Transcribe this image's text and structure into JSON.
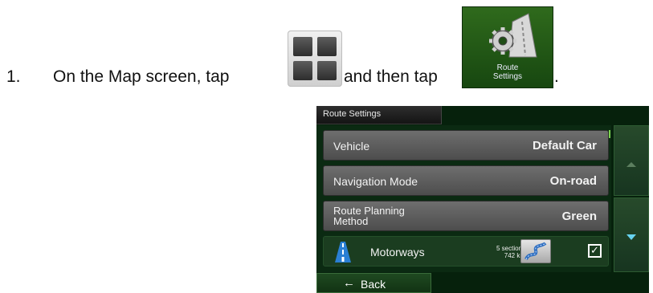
{
  "instruction": {
    "number": "1.",
    "part1": "On the Map screen, tap",
    "part2": "and then tap",
    "end": "."
  },
  "route_settings_button": {
    "label_line1": "Route",
    "label_line2": "Settings"
  },
  "device": {
    "title": "Route Settings",
    "rows": [
      {
        "label": "Vehicle",
        "value": "Default Car"
      },
      {
        "label": "Navigation Mode",
        "value": "On-road"
      },
      {
        "label_line1": "Route Planning",
        "label_line2": "Method",
        "value": "Green"
      },
      {
        "label": "Motorways",
        "sections": "5 sections",
        "distance": "742 km",
        "checked": true
      }
    ],
    "back_label": "Back",
    "colors": {
      "screen_bg": "#06210c",
      "row_bg": "#5e5e5e",
      "accent": "#67d3f0"
    }
  }
}
